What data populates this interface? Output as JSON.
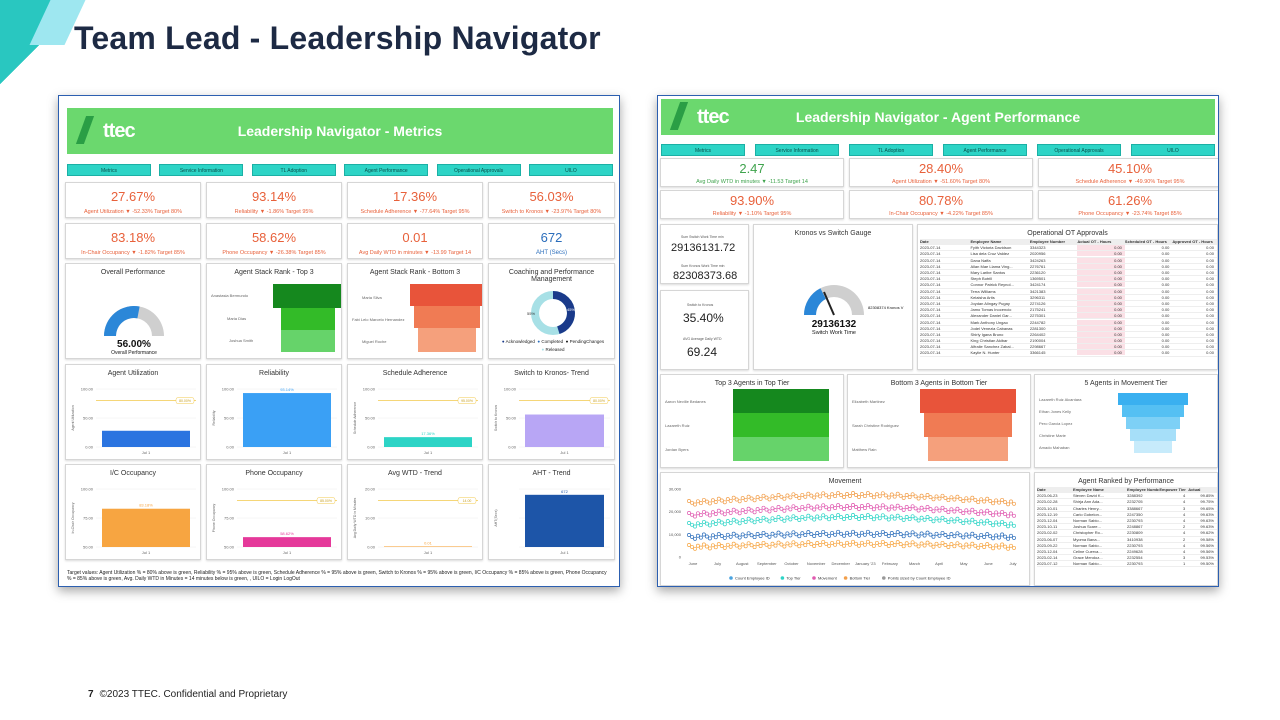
{
  "slide": {
    "title": "Team Lead - Leadership Navigator",
    "page": "7",
    "footer": "©2023 TTEC. Confidential and Proprietary"
  },
  "colors": {
    "green": "#6bd86e",
    "teal": "#2dd4c6",
    "orange": "#e8613b",
    "blue": "#2a6dbb"
  },
  "left": {
    "logo": "ttec",
    "title": "Leadership Navigator - Metrics",
    "tabs": [
      "Metrics",
      "Service Information",
      "TL Adoption",
      "Agent Performance",
      "Operational Approvals",
      "UILO"
    ],
    "kpis": [
      {
        "value": "27.67%",
        "sub": "Agent Utilization ▼ -52.33% Target 80%"
      },
      {
        "value": "93.14%",
        "sub": "Reliability ▼ -1.86% Target 95%"
      },
      {
        "value": "17.36%",
        "sub": "Schedule Adherence ▼ -77.64% Target 95%"
      },
      {
        "value": "56.03%",
        "sub": "Switch to Kronos ▼ -23.97% Target 80%"
      },
      {
        "value": "83.18%",
        "sub": "In-Chair Occupancy ▼ -1.82% Target 85%"
      },
      {
        "value": "58.62%",
        "sub": "Phone Occupancy ▼ -26.38% Target 85%"
      },
      {
        "value": "0.01",
        "sub": "Avg Daily WTD in minutes ▼ -13.99 Target 14"
      },
      {
        "value": "672",
        "sub": "AHT (Secs)"
      }
    ],
    "overall": {
      "title": "Overall Performance",
      "value": "56.00%",
      "label": "Overall Performance",
      "fraction": 0.56
    },
    "top3": {
      "title": "Agent Stack Rank - Top 3",
      "names": [
        "Anastasia Bermundo",
        "Maria Dias",
        "Joshua Smith"
      ]
    },
    "bottom3": {
      "title": "Agent Stack Rank - Bottom 3",
      "names": [
        "Maria Silva",
        "Fabi Lelo Marcelo Hernandez",
        "Miguel Roche"
      ]
    },
    "coaching": {
      "title": "Coaching and Performance Management",
      "legend": [
        "Acknowledged",
        "Completed",
        "PendingChanges",
        "Released"
      ],
      "p1": "45%",
      "p2": "55%"
    },
    "bars": [
      {
        "title": "Agent Utilization",
        "ylabel": "Agent Utilization",
        "ticks": [
          "100.00",
          "50.00",
          "0.00"
        ],
        "target": "80.00%",
        "value": 0.28,
        "color": "#2b74e0",
        "cat": "Jul 1"
      },
      {
        "title": "Reliability",
        "ylabel": "Reliability",
        "ticks": [
          "100.00",
          "50.00",
          "0.00"
        ],
        "target": "",
        "value": 0.93,
        "color": "#3aa0f5",
        "cat": "Jul 1",
        "label": "93.14%"
      },
      {
        "title": "Schedule Adherence",
        "ylabel": "Schedule Adherence",
        "ticks": [
          "100.00",
          "50.00",
          "0.00"
        ],
        "target": "95.00%",
        "value": 0.17,
        "color": "#2dd4c6",
        "cat": "Jul 1",
        "label": "17.36%"
      },
      {
        "title": "Switch to Kronos- Trend",
        "ylabel": "Switch to Kronos",
        "ticks": [
          "100.00",
          "50.00",
          "0.00"
        ],
        "target": "80.00%",
        "value": 0.56,
        "color": "#b8a6f5",
        "cat": "Jul 1"
      },
      {
        "title": "I/C Occupancy",
        "ylabel": "In-Chair Occupancy",
        "ticks": [
          "100.00",
          "75.00",
          "50.00"
        ],
        "target": "",
        "value": 0.66,
        "color": "#f7a541",
        "cat": "Jul 1",
        "label": "83.18%"
      },
      {
        "title": "Phone Occupancy",
        "ylabel": "Phone Occupancy",
        "ticks": [
          "100.00",
          "75.00",
          "50.00"
        ],
        "target": "85.00%",
        "value": 0.17,
        "color": "#e5399a",
        "cat": "Jul 1",
        "label": "58.62%"
      },
      {
        "title": "Avg WTD - Trend",
        "ylabel": "Avg Daily WTD in Minutes",
        "ticks": [
          "20.00",
          "10.00",
          "0.00"
        ],
        "target": "14.00",
        "value": 0.01,
        "color": "#f7a541",
        "cat": "Jul 1",
        "label": "0.01"
      },
      {
        "title": "AHT - Trend",
        "ylabel": "AHT(Secs)",
        "ticks": [
          "",
          "",
          ""
        ],
        "target": "",
        "value": 0.9,
        "color": "#1d55a8",
        "cat": "Jul 1",
        "label": "672"
      }
    ],
    "note": "Target values: Agent Utilization % = 80% above is green, Reliability % = 95% above is green, Schedule Adherence % = 95% above is green, Switch to Kronos % = 95% above is green, I/C Occupancy % = 85% above is green, Phone Occupancy % = 85% above is green, Avg. Daily WTD in Minutes = 14 minutes below is green, , UILO = Login LogOut"
  },
  "right": {
    "logo": "ttec",
    "title": "Leadership Navigator - Agent Performance",
    "tabs": [
      "Metrics",
      "Service Information",
      "TL Adoption",
      "Agent Performance",
      "Operational Approvals",
      "UILO"
    ],
    "kpis": [
      {
        "value": "2.47",
        "sub": "Avg Daily WTD in minutes ▼ -11.53 Target 14"
      },
      {
        "value": "28.40%",
        "sub": "Agent Utilization ▼ -51.60% Target 80%"
      },
      {
        "value": "45.10%",
        "sub": "Schedule Adherence ▼ -49.90% Target 95%"
      },
      {
        "value": "93.90%",
        "sub": "Reliability ▼ -1.10% Target 95%"
      },
      {
        "value": "80.78%",
        "sub": "In-Chair Occupancy ▼ -4.22% Target 85%"
      },
      {
        "value": "61.26%",
        "sub": "Phone Occupancy ▼ -23.74% Target 85%"
      }
    ],
    "side": [
      {
        "label": "Sum Switch Work Time min",
        "value": "29136131.72"
      },
      {
        "label": "Sum Kronos Work Time min",
        "value": "82308373.68"
      },
      {
        "label": "Switch to Kronos",
        "value": "35.40%"
      },
      {
        "label": "AVG Average Daily WTD",
        "value": "69.24"
      }
    ],
    "gauge": {
      "title": "Kronos vs Switch Gauge",
      "value": "29136132",
      "label": "Switch Work Time",
      "right": "82308374 Kronos V",
      "fraction": 0.35
    },
    "ot": {
      "title": "Operational OT Approvals",
      "headers": [
        "Date",
        "Employee Name",
        "Employee Number",
        "Actual OT - Hours",
        "Scheduled OT - Hours",
        "Approved OT - Hours"
      ],
      "rows": [
        [
          "2023-07-14",
          "Fyith Victoria Davidson",
          "3344323",
          "0.00",
          "0.00",
          "0.00"
        ],
        [
          "2023-07-14",
          "Lisa dela Cruz Valdez",
          "2020956",
          "0.00",
          "0.00",
          "0.00"
        ],
        [
          "2023-07-14",
          "Dana Naffa",
          "3424263",
          "0.00",
          "0.00",
          "0.00"
        ],
        [
          "2023-07-14",
          "Allan Mae Llama Ving...",
          "2276761",
          "0.00",
          "0.00",
          "0.00"
        ],
        [
          "2023-07-14",
          "Mary Laribe Santos",
          "2236120",
          "0.00",
          "0.00",
          "0.00"
        ],
        [
          "2023-07-14",
          "Steph Botrill",
          "1369501",
          "0.00",
          "0.00",
          "0.00"
        ],
        [
          "2023-07-14",
          "Connor Patrick Reynol...",
          "3424174",
          "0.00",
          "0.00",
          "0.00"
        ],
        [
          "2023-07-14",
          "Terra Williams",
          "3421383",
          "0.00",
          "0.00",
          "0.00"
        ],
        [
          "2023-07-14",
          "Kelaisha Artis",
          "3296311",
          "0.00",
          "0.00",
          "0.00"
        ],
        [
          "2023-07-14",
          "Joydan Alingay Pugay",
          "2274126",
          "0.00",
          "0.00",
          "0.00"
        ],
        [
          "2023-07-14",
          "Jamo Tomas Inocencio",
          "2175241",
          "0.00",
          "0.00",
          "0.00"
        ],
        [
          "2023-07-14",
          "Alexander Daniel Gar...",
          "2275301",
          "0.00",
          "0.00",
          "0.00"
        ],
        [
          "2023-07-14",
          "Mark Anthony Ungao",
          "2244782",
          "0.00",
          "0.00",
          "0.00"
        ],
        [
          "2023-07-14",
          "Jodel Venezia Cabanas",
          "2281300",
          "0.00",
          "0.00",
          "0.00"
        ],
        [
          "2023-07-14",
          "Shirly Igana Bruno",
          "2264402",
          "0.00",
          "0.00",
          "0.00"
        ],
        [
          "2023-07-14",
          "King Christian Akibar",
          "2190004",
          "0.00",
          "0.00",
          "0.00"
        ],
        [
          "2023-07-14",
          "Alfralie Sanchez Zabal...",
          "2298667",
          "0.00",
          "0.00",
          "0.00"
        ],
        [
          "2023-07-14",
          "Kaylie N. Hunter",
          "3366145",
          "0.00",
          "0.00",
          "0.00"
        ]
      ]
    },
    "tiers": [
      {
        "title": "Top 3 Agents in Top Tier",
        "names": [
          "Aaron Neville Bedanes",
          "Lazareth Ruiz",
          "Jordan Byers"
        ]
      },
      {
        "title": "Bottom 3 Agents in Bottom Tier",
        "names": [
          "Elizabeth Martinez",
          "Sarah Christine Rodriguez",
          "Matthew Rain"
        ]
      },
      {
        "title": "5 Agents in Movement Tier",
        "names": [
          "Lazareth Ruiz Alcantara",
          "Ethan Jones Kelly",
          "Pero Garcia Lopez",
          "Christine Marie",
          "Amado Mahaban"
        ]
      }
    ],
    "movement": {
      "title": "Movement",
      "yticks": [
        "30,000",
        "20,000",
        "10,000",
        "0"
      ],
      "months": [
        "June",
        "July",
        "August",
        "September",
        "October",
        "November",
        "December",
        "January '23",
        "February",
        "March",
        "April",
        "May",
        "June",
        "July"
      ],
      "legend": [
        "Count Employee ID",
        "Top Tier",
        "Movement",
        "Bottom Tier",
        "Points sized by Count Employee ID"
      ]
    },
    "ranked": {
      "title": "Agent Ranked by Performance",
      "headers": [
        "Date",
        "Employee Name",
        "Employee Number",
        "Empower Tier",
        "Actual"
      ],
      "rows": [
        [
          "2023-06-23",
          "Steven David K...",
          "3288392",
          "4",
          "99.85%"
        ],
        [
          "2023-02-28",
          "Shirja Ann Ada...",
          "2232705",
          "4",
          "99.75%"
        ],
        [
          "2023-10-01",
          "Charles Henry...",
          "3388667",
          "3",
          "99.65%"
        ],
        [
          "2023-12-19",
          "Carlo Gobelon...",
          "2247350",
          "4",
          "99.63%"
        ],
        [
          "2023-12-04",
          "Norman Sabio...",
          "2230793",
          "4",
          "99.63%"
        ],
        [
          "2023-10-11",
          "Joshua Scare...",
          "2248867",
          "2",
          "99.63%"
        ],
        [
          "2023-02-02",
          "Christopher Ro...",
          "2230809",
          "4",
          "99.62%"
        ],
        [
          "2023-06-07",
          "Myoma Bana...",
          "3410938",
          "2",
          "99.58%"
        ],
        [
          "2023-09-22",
          "Norman Sabio...",
          "2230793",
          "4",
          "99.56%"
        ],
        [
          "2023-12-04",
          "Celine Cuerva...",
          "2249628",
          "4",
          "99.56%"
        ],
        [
          "2023-02-14",
          "Grace Mendoz...",
          "2232554",
          "3",
          "99.53%"
        ],
        [
          "2023-07-12",
          "Norman Sabio...",
          "2230793",
          "1",
          "99.50%"
        ]
      ]
    }
  }
}
